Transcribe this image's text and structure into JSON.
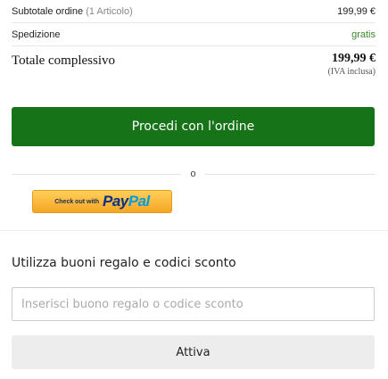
{
  "summary": {
    "subtotal_label": "Subtotale ordine",
    "subtotal_count": "(1 Articolo)",
    "subtotal_value": "199,99 €",
    "shipping_label": "Spedizione",
    "shipping_value": "gratis",
    "total_label": "Totale complessivo",
    "total_value": "199,99 €",
    "total_vat_note": "(IVA inclusa)"
  },
  "checkout": {
    "order_button_label": "Procedi con l'ordine",
    "or_text": "o",
    "paypal_prefix": "Check out with",
    "paypal_logo_pay": "Pay",
    "paypal_logo_pal": "Pal"
  },
  "gift": {
    "heading": "Utilizza buoni regalo e codici sconto",
    "input_placeholder": "Inserisci buono regalo o codice sconto",
    "input_value": "",
    "activate_label": "Attiva"
  },
  "colors": {
    "primary_green": "#177318",
    "free_green": "#3a8a2a",
    "paypal_gold": "#f5a623"
  }
}
